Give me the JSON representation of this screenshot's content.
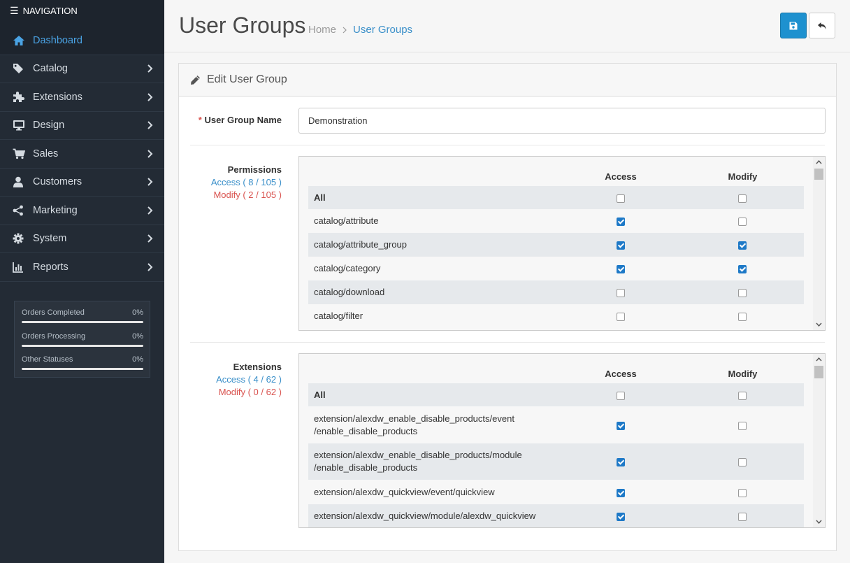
{
  "nav": {
    "header": "NAVIGATION",
    "items": [
      {
        "label": "Dashboard",
        "icon": "home-icon"
      },
      {
        "label": "Catalog",
        "icon": "tag-icon"
      },
      {
        "label": "Extensions",
        "icon": "puzzle-icon"
      },
      {
        "label": "Design",
        "icon": "monitor-icon"
      },
      {
        "label": "Sales",
        "icon": "cart-icon"
      },
      {
        "label": "Customers",
        "icon": "user-icon"
      },
      {
        "label": "Marketing",
        "icon": "share-icon"
      },
      {
        "label": "System",
        "icon": "gear-icon"
      },
      {
        "label": "Reports",
        "icon": "bar-chart-icon"
      }
    ],
    "stats": [
      {
        "label": "Orders Completed",
        "value": "0%",
        "fraction": 0
      },
      {
        "label": "Orders Processing",
        "value": "0%",
        "fraction": 0
      },
      {
        "label": "Other Statuses",
        "value": "0%",
        "fraction": 0
      }
    ]
  },
  "header": {
    "title": "User Groups",
    "breadcrumb": {
      "home": "Home",
      "sep": ">",
      "current": "User Groups"
    }
  },
  "panel": {
    "heading": "Edit User Group",
    "name_label": "User Group Name",
    "required_mark": "*",
    "name_value": "Demonstration",
    "col_access": "Access",
    "col_modify": "Modify"
  },
  "permissions": {
    "title": "Permissions",
    "access_count": "Access ( 8 / 105 )",
    "modify_count": "Modify ( 2 / 105 )",
    "rows": [
      {
        "path": "All",
        "access": false,
        "modify": false,
        "bold": true
      },
      {
        "path": "catalog/attribute",
        "access": true,
        "modify": false
      },
      {
        "path": "catalog/attribute_group",
        "access": true,
        "modify": true
      },
      {
        "path": "catalog/category",
        "access": true,
        "modify": true
      },
      {
        "path": "catalog/download",
        "access": false,
        "modify": false
      },
      {
        "path": "catalog/filter",
        "access": false,
        "modify": false
      }
    ]
  },
  "extensions": {
    "title": "Extensions",
    "access_count": "Access ( 4 / 62 )",
    "modify_count": "Modify ( 0 / 62 )",
    "rows": [
      {
        "path": "All",
        "access": false,
        "modify": false,
        "bold": true
      },
      {
        "path_line1": "extension/alexdw_enable_disable_products/event",
        "path_line2": "/enable_disable_products",
        "access": true,
        "modify": false
      },
      {
        "path_line1": "extension/alexdw_enable_disable_products/module",
        "path_line2": "/enable_disable_products",
        "access": true,
        "modify": false
      },
      {
        "path": "extension/alexdw_quickview/event/quickview",
        "access": true,
        "modify": false
      },
      {
        "path": "extension/alexdw_quickview/module/alexdw_quickview",
        "access": true,
        "modify": false
      }
    ]
  }
}
